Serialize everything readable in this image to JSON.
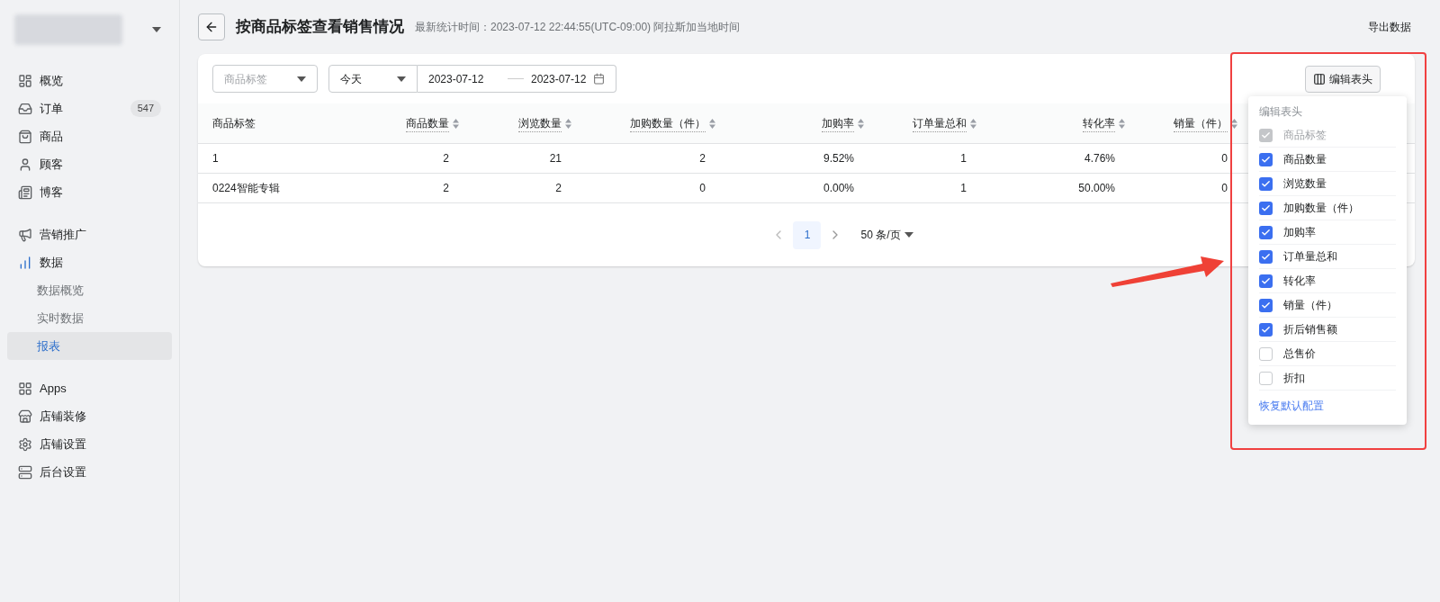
{
  "sidebar": {
    "groups": [
      {
        "items": [
          {
            "label": "概览",
            "active": false
          },
          {
            "label": "订单",
            "active": false,
            "badge": "547"
          },
          {
            "label": "商品",
            "active": false
          },
          {
            "label": "顾客",
            "active": false
          },
          {
            "label": "博客",
            "active": false
          }
        ]
      },
      {
        "items": [
          {
            "label": "营销推广",
            "active": false
          },
          {
            "label": "数据",
            "active": true,
            "children": [
              {
                "label": "数据概览",
                "selected": false
              },
              {
                "label": "实时数据",
                "selected": false
              },
              {
                "label": "报表",
                "selected": true
              }
            ]
          }
        ]
      },
      {
        "items": [
          {
            "label": "Apps",
            "active": false
          },
          {
            "label": "店铺装修",
            "active": false
          },
          {
            "label": "店铺设置",
            "active": false
          },
          {
            "label": "后台设置",
            "active": false
          }
        ]
      }
    ]
  },
  "header": {
    "title": "按商品标签查看销售情况",
    "subtitle": "最新统计时间：2023-07-12 22:44:55(UTC-09:00) 阿拉斯加当地时间",
    "export": "导出数据"
  },
  "filters": {
    "tag": {
      "placeholder": "商品标签"
    },
    "range": {
      "value": "今天"
    },
    "start": "2023-07-12",
    "end": "2023-07-12",
    "edit_columns": "编辑表头"
  },
  "table": {
    "columns": [
      {
        "label": "商品标签",
        "sortable": false
      },
      {
        "label": "商品数量",
        "sortable": true
      },
      {
        "label": "浏览数量",
        "sortable": true
      },
      {
        "label": "加购数量（件）",
        "sortable": true
      },
      {
        "label": "加购率",
        "sortable": true
      },
      {
        "label": "订单量总和",
        "sortable": true
      },
      {
        "label": "转化率",
        "sortable": true
      },
      {
        "label": "销量（件）",
        "sortable": true
      }
    ],
    "rows": [
      [
        "1",
        "2",
        "21",
        "2",
        "9.52%",
        "1",
        "4.76%",
        "0"
      ],
      [
        "0224智能专辑",
        "2",
        "2",
        "0",
        "0.00%",
        "1",
        "50.00%",
        "0"
      ]
    ]
  },
  "pagination": {
    "pages": [
      {
        "label": "1",
        "selected": true
      }
    ],
    "page_size": "50 条/页"
  },
  "column_menu": {
    "title": "编辑表头",
    "options": [
      {
        "label": "商品标签",
        "checked": true,
        "disabled": true
      },
      {
        "label": "商品数量",
        "checked": true,
        "disabled": false
      },
      {
        "label": "浏览数量",
        "checked": true,
        "disabled": false
      },
      {
        "label": "加购数量（件）",
        "checked": true,
        "disabled": false
      },
      {
        "label": "加购率",
        "checked": true,
        "disabled": false
      },
      {
        "label": "订单量总和",
        "checked": true,
        "disabled": false
      },
      {
        "label": "转化率",
        "checked": true,
        "disabled": false
      },
      {
        "label": "销量（件）",
        "checked": true,
        "disabled": false
      },
      {
        "label": "折后销售额",
        "checked": true,
        "disabled": false
      },
      {
        "label": "总售价",
        "checked": false,
        "disabled": false
      },
      {
        "label": "折扣",
        "checked": false,
        "disabled": false
      }
    ],
    "reset": "恢复默认配置"
  }
}
